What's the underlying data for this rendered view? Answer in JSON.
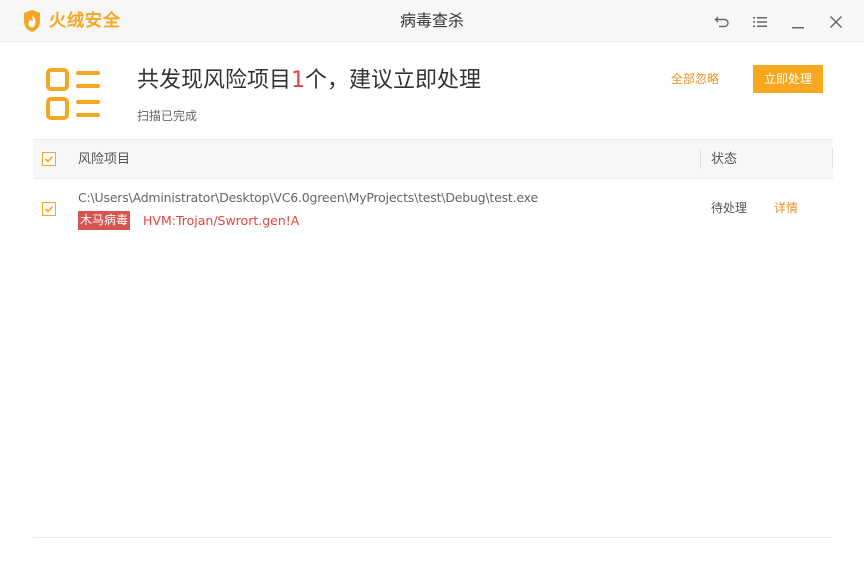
{
  "app": {
    "brand": "火绒安全",
    "window_title": "病毒查杀",
    "accent_color": "#f5a623",
    "danger_color": "#e8423c"
  },
  "window_controls": [
    {
      "name": "back-icon"
    },
    {
      "name": "menu-icon"
    },
    {
      "name": "minimize-icon"
    },
    {
      "name": "close-icon"
    }
  ],
  "summary": {
    "title_prefix": "共发现风险项目",
    "count": "1",
    "title_suffix": "个，建议立即处理",
    "subtitle": "扫描已完成",
    "ignore_all_label": "全部忽略",
    "process_now_label": "立即处理"
  },
  "table": {
    "headers": {
      "name": "风险项目",
      "status": "状态"
    },
    "header_checked": true,
    "rows": [
      {
        "checked": true,
        "path": "C:\\Users\\Administrator\\Desktop\\VC6.0green\\MyProjects\\test\\Debug\\test.exe",
        "type_badge": "木马病毒",
        "virus_name": "HVM:Trojan/Swrort.gen!A",
        "status": "待处理",
        "detail_label": "详情"
      }
    ]
  }
}
